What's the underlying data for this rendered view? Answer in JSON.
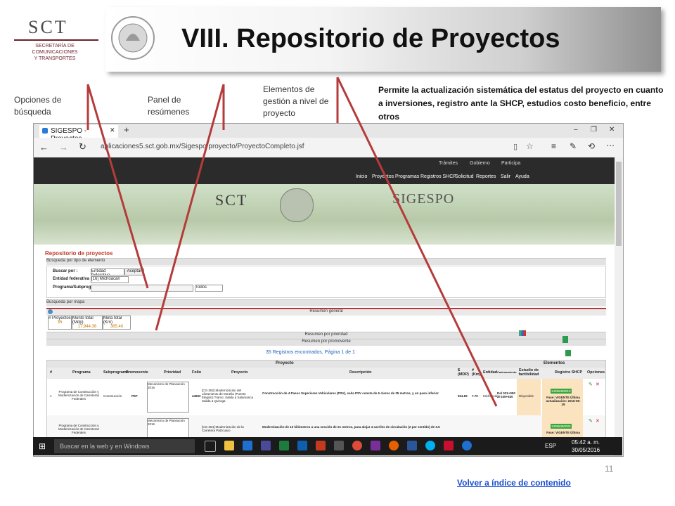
{
  "header": {
    "title": "VIII. Repositorio de Proyectos",
    "logo_big": "SCT",
    "logo_small_1": "SECRETARÍA DE",
    "logo_small_2": "COMUNICACIONES",
    "logo_small_3": "Y TRANSPORTES"
  },
  "callouts": {
    "opciones_1": "Opciones de",
    "opciones_2": "búsqueda",
    "panel_1": "Panel de",
    "panel_2": "resúmenes",
    "elementos_1": "Elementos de",
    "elementos_2": "gestión a nivel de",
    "elementos_3": "proyecto",
    "description": "Permite la actualización sistemática del estatus del proyecto en cuanto a inversiones, registro ante la SHCP, estudios costo beneficio, entre otros"
  },
  "browser": {
    "tab_title": "SIGESPO - Proyectos",
    "url": "aplicaciones5.sct.gob.mx/Sigespo/proyecto/ProyectoCompleto.jsf",
    "gov_links": [
      "Trámites",
      "Gobierno",
      "Participa"
    ],
    "nav_links": [
      "Inicio",
      "Proyectos",
      "Programas",
      "Registros SHCP",
      "Solicitud",
      "Reportes",
      "Salir",
      "Ayuda"
    ],
    "banner_sct": "SCT",
    "banner_sigespo": "SIGESPO"
  },
  "page": {
    "title": "Repositorio de proyectos",
    "sec_busqueda": "Búsqueda por tipo de elemento",
    "buscar_por": "Buscar por :",
    "buscar_value": "Entidad federativa",
    "aceptar": "Aceptar",
    "entidad_label": "Entidad federativa",
    "entidad_value": "[16] Michoacán",
    "programa_label": "Programa/Subprograma :",
    "todos": "Todos",
    "sec_mapa": "Búsqueda por mapa",
    "resumen_general": "Resumen general",
    "num_proyectos_label": "# Proyectos",
    "num_proyectos": "35",
    "monto_label": "Monto total (Mdp)",
    "monto": "17,944.36",
    "meta_label": "Meta total (Km)",
    "meta": "385.40",
    "resumen_prioridad": "Resumen por prioridad",
    "resumen_promovente": "Resumen por promovente",
    "registros": "35 Registros encontrados, Página 1 de 1",
    "proyecto_group": "Proyecto",
    "elementos_group": "Elementos",
    "columns": [
      "#",
      "Programa",
      "Subprograma",
      "Promovente",
      "Prioridad",
      "Folio",
      "Proyecto",
      "Descripción",
      "$ (MDP)",
      "# (Km)",
      "Entidad",
      "Cadenamiento",
      "Estudio de factibilidad",
      "Registro SHCP",
      "Opciones"
    ],
    "row1": {
      "num": "1",
      "programa": "Programa de Construcción y Modernización de Carreteras Federales",
      "subprograma": "Construcción",
      "promovente": "PEF",
      "prioridad": "Mecanismo de Planeación 2016",
      "folio": "44692",
      "proyecto": "[CG-352] Modernización del Libramiento de Morelia (Puente Elegido) Tramo: Salida a Salamanca Salida a Quiroga",
      "descripcion": "Construcción de 4 Pasos Superiores Vehiculares (PSV), seda PSV consta de 6 claros de 35 metros, y un paso inferior",
      "mdp": "554.82",
      "km": "7.70",
      "entidad": "Michoacán",
      "cadenamiento": "Del 031+000 al 035+630",
      "estudio": "Disponible",
      "shcp_id": "14096360010",
      "shcp_fase": "Fase: VIGENTE Última actualización: 2016-06-29"
    },
    "row2": {
      "programa": "Programa de Construcción y Modernización de Carreteras Federales",
      "prioridad": "Mecanismo de Planeación 2016",
      "proyecto": "[CG-354] Modernización de la Carretera Pátzcuaro",
      "descripcion": "Modernización de 10 kilómetros a una sección de 21 metros, para alojar 4 carriles de circulación (2 por sentido) de 3.5",
      "shcp_id": "13096360003",
      "shcp_fase": "Fase: VIGENTE Última"
    }
  },
  "taskbar": {
    "search_placeholder": "Buscar en la web y en Windows",
    "lang": "ESP",
    "time": "05:42 a. m.",
    "date": "30/05/2016"
  },
  "footer": {
    "page_number": "11",
    "back_link": "Volver a índice de contenido"
  },
  "colors": {
    "accent_red": "#b53b3b",
    "gov_bar": "#2b2b2b",
    "link_blue": "#1a4fd1",
    "page_title_red": "#c0392b"
  }
}
